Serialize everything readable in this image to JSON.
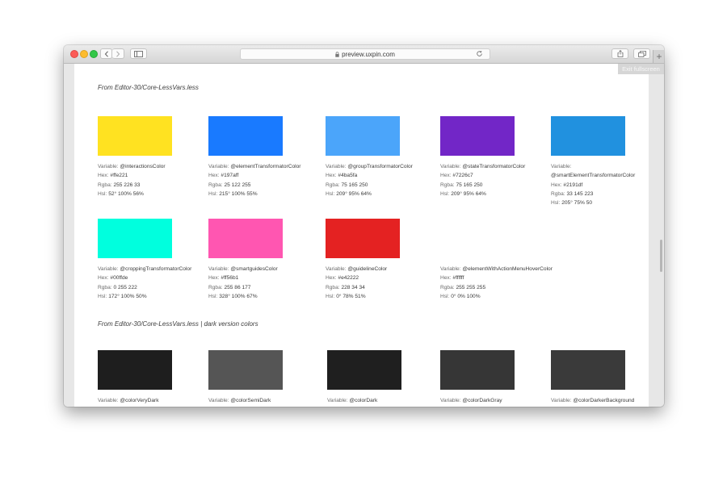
{
  "browser": {
    "url": "preview.uxpin.com",
    "exit_fullscreen": "Exit fullscreen"
  },
  "labels": {
    "variable": "Variable:",
    "hex": "Hex:",
    "rgba": "Rgba:",
    "hsl": "Hsl:"
  },
  "sections": [
    {
      "heading": "From Editor-30/Core-LessVars.less",
      "subheading": ""
    },
    {
      "heading": "From Editor-30/Core-LessVars.less",
      "subheading": " | dark version colors"
    }
  ],
  "swatches": [
    {
      "color": "#ffe221",
      "variable": "@interactionsColor",
      "hex": "#ffe221",
      "rgba": "255 226 33",
      "hsl": "52° 100% 56%"
    },
    {
      "color": "#197aff",
      "variable": "@elementTransformatorColor",
      "hex": "#197aff",
      "rgba": "25 122 255",
      "hsl": "215° 100% 55%"
    },
    {
      "color": "#4ba5fa",
      "variable": "@groupTransformatorColor",
      "hex": "#4ba5fa",
      "rgba": "75 165 250",
      "hsl": "209° 95% 64%"
    },
    {
      "color": "#7226c7",
      "variable": "@stateTransformatorColor",
      "hex": "#7226c7",
      "rgba": "75 165 250",
      "hsl": "209° 95% 64%"
    },
    {
      "color": "#2191df",
      "variable": "",
      "variable_wrapped": "@smartElementTransformatorColor",
      "hex": "#2191df",
      "rgba": "33 145 223",
      "hsl": "205° 75% 50"
    },
    {
      "color": "#00ffde",
      "variable": "@croppingTransformatorColor",
      "hex": "#00ffde",
      "rgba": "0 255 222",
      "hsl": "172° 100% 50%"
    },
    {
      "color": "#ff56b1",
      "variable": "@smartguidesColor",
      "hex": "#ff56b1",
      "rgba": "255 86 177",
      "hsl": "328° 100% 67%"
    },
    {
      "color": "#e42222",
      "variable": "@guidelineColor",
      "hex": "#e42222",
      "rgba": "228 34 34",
      "hsl": "0° 78% 51%"
    },
    {
      "color": "#ffffff",
      "variable": "@elementWithActionMenuHoverColor",
      "hex": "#ffffff",
      "rgba": "255 255 255",
      "hsl": "0° 0% 100%"
    },
    {
      "color": "#1e1e1e",
      "variable": "@colorVeryDark"
    },
    {
      "color": "#555555",
      "variable": "@colorSemiDark"
    },
    {
      "color": "#1f1f1f",
      "variable": "@colorDark"
    },
    {
      "color": "#363636",
      "variable": "@colorDarkGray"
    },
    {
      "color": "#3a3a3a",
      "variable": "@colorDarkerBackground"
    }
  ]
}
